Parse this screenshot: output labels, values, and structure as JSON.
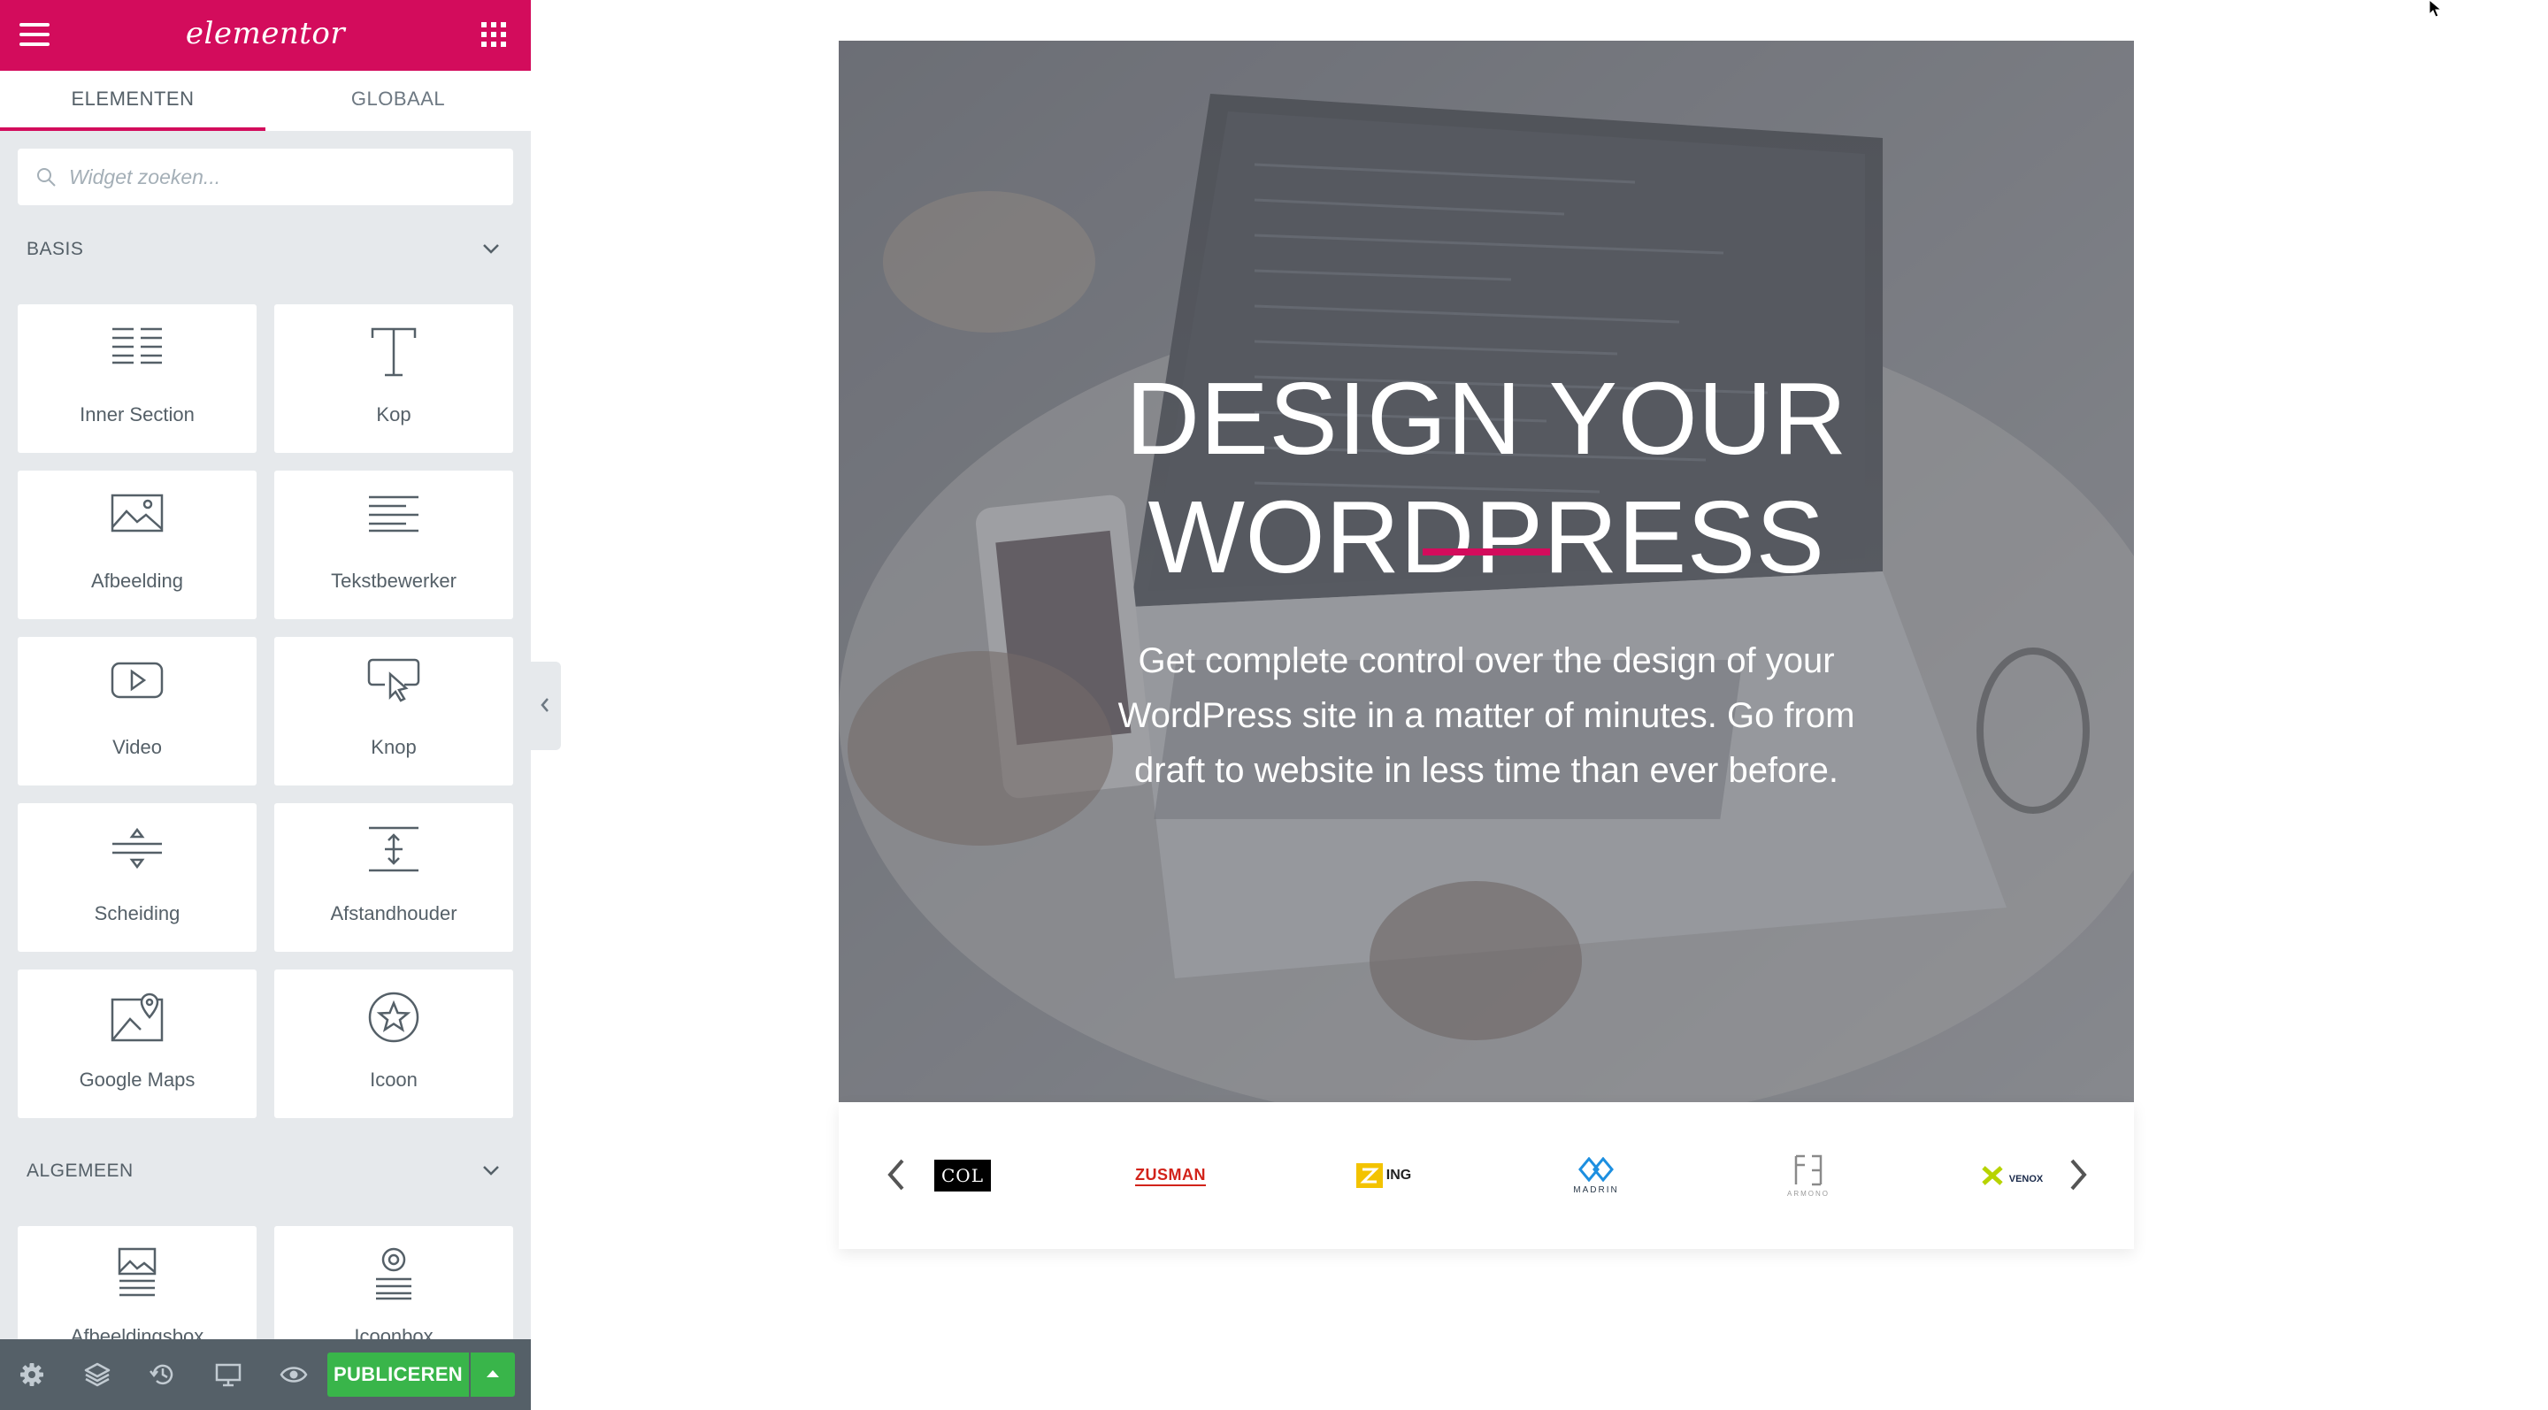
{
  "panel": {
    "header": {
      "logo_text": "elementor",
      "menu_icon": "hamburger-icon",
      "apps_icon": "grid-icon"
    },
    "tabs": [
      {
        "label": "ELEMENTEN",
        "active": true
      },
      {
        "label": "GLOBAAL",
        "active": false
      }
    ],
    "search": {
      "placeholder": "Widget zoeken...",
      "value": ""
    },
    "sections": {
      "basis": {
        "title": "BASIS",
        "widgets": [
          {
            "label": "Inner Section",
            "icon": "inner-section-icon"
          },
          {
            "label": "Kop",
            "icon": "heading-icon"
          },
          {
            "label": "Afbeelding",
            "icon": "image-icon"
          },
          {
            "label": "Tekstbewerker",
            "icon": "text-editor-icon"
          },
          {
            "label": "Video",
            "icon": "video-icon"
          },
          {
            "label": "Knop",
            "icon": "button-icon"
          },
          {
            "label": "Scheiding",
            "icon": "divider-icon"
          },
          {
            "label": "Afstandhouder",
            "icon": "spacer-icon"
          },
          {
            "label": "Google Maps",
            "icon": "map-icon"
          },
          {
            "label": "Icoon",
            "icon": "star-icon"
          }
        ]
      },
      "algemeen": {
        "title": "ALGEMEEN",
        "widgets": [
          {
            "label": "Afbeeldingsbox",
            "icon": "image-box-icon"
          },
          {
            "label": "Icoonbox",
            "icon": "icon-box-icon"
          }
        ]
      }
    },
    "footer": {
      "publish_label": "PUBLICEREN",
      "icons": [
        "settings-icon",
        "navigator-icon",
        "history-icon",
        "responsive-icon",
        "preview-icon"
      ]
    }
  },
  "hero": {
    "heading": "DESIGN YOUR WORDPRESS",
    "text": "Get complete control over the design of your WordPress site in a matter of minutes. Go from draft to website in less time than ever before.",
    "accent_color": "#d30c5c"
  },
  "logo_carousel": {
    "brands": [
      {
        "name": "COL"
      },
      {
        "name": "ZUSMAN"
      },
      {
        "name": "ING"
      },
      {
        "name": "MADRIN"
      },
      {
        "name": "ARMONO"
      },
      {
        "name": "VENOX"
      }
    ]
  },
  "colors": {
    "brand": "#d30c5c",
    "publish": "#39b54a",
    "panel_bg": "#e6e9ec",
    "footer_bg": "#556068"
  }
}
